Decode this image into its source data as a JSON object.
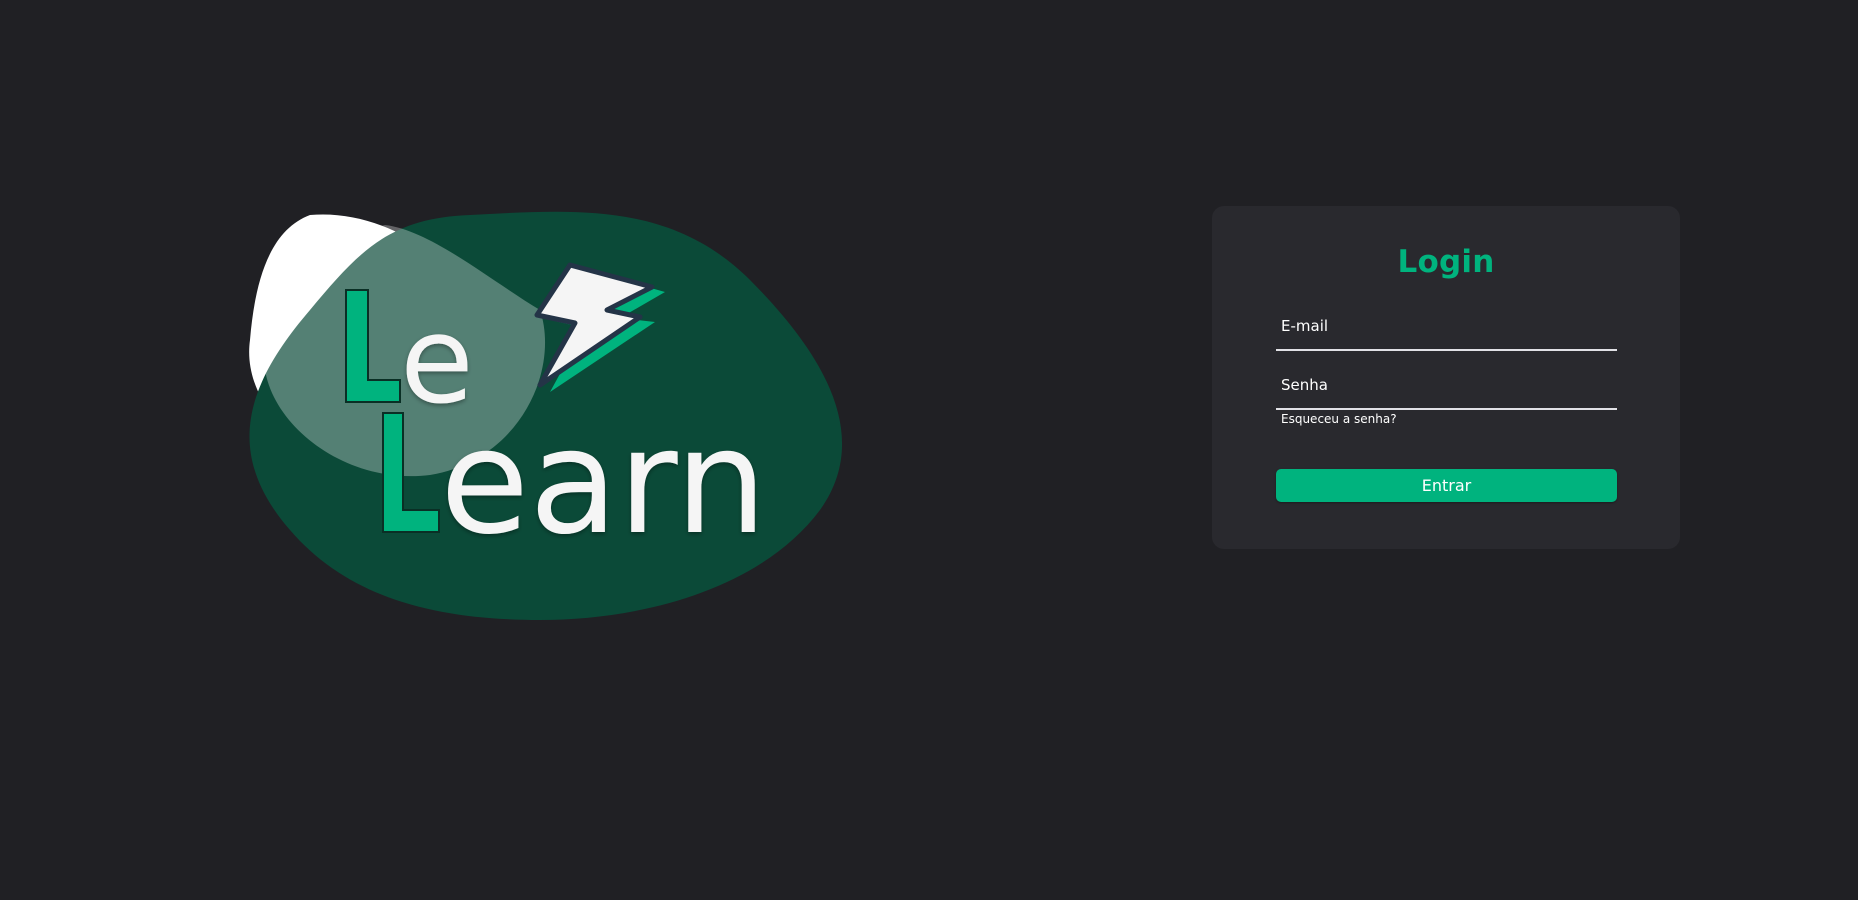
{
  "brand": {
    "logo_word_top": "Le",
    "logo_word_bottom": "Learn",
    "accent_color": "#00b37e",
    "blob_color": "#0b4a38",
    "bolt_icon": "lightning-bolt-icon"
  },
  "login": {
    "title": "Login",
    "email_placeholder": "E-mail",
    "password_placeholder": "Senha",
    "forgot_password_label": "Esqueceu a senha?",
    "submit_label": "Entrar"
  },
  "theme": {
    "background": "#202024",
    "card_background": "#29292e",
    "text_color": "#ffffff"
  }
}
